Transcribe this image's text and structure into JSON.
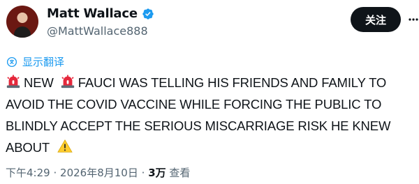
{
  "author": {
    "display_name": "Matt Wallace",
    "handle": "@MattWallace888",
    "verified_icon": "verified-badge-icon",
    "avatar_icon": "profile-avatar"
  },
  "actions": {
    "follow_label": "关注",
    "more_icon": "more-options-icon"
  },
  "translate": {
    "label": "显示翻译",
    "icon": "translate-icon"
  },
  "tweet": {
    "text_after_first_siren": "NEW",
    "text_after_second_siren": "FAUCI WAS TELLING HIS FRIENDS AND FAMILY TO AVOID THE COVID VACCINE WHILE FORCING THE PUBLIC TO BLINDLY ACCEPT THE SERIOUS MISCARRIAGE RISK HE KNEW ABOUT",
    "emoji_1": "siren-icon",
    "emoji_2": "siren-icon",
    "emoji_3": "warning-icon"
  },
  "meta": {
    "time": "下午4:29",
    "separator_1": "·",
    "date": "2026年8月10日",
    "separator_2": "·",
    "views_count": "3万",
    "views_label": "查看"
  },
  "colors": {
    "accent": "#1d9bf0",
    "text": "#0f1419",
    "muted": "#536471",
    "button_bg": "#0f1419",
    "button_text": "#ffffff"
  }
}
